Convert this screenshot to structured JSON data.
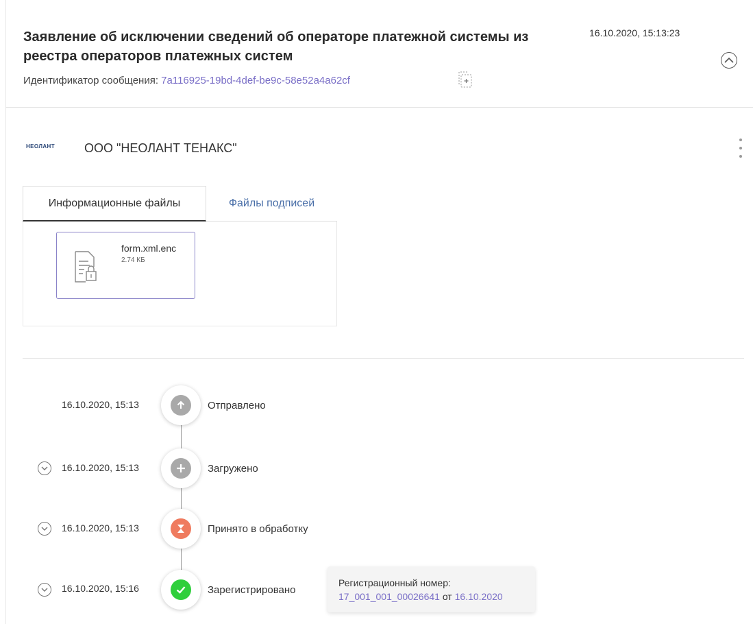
{
  "header": {
    "title": "Заявление об исключении сведений об операторе платежной системы из реестра операторов платежных систем",
    "timestamp": "16.10.2020, 15:13:23",
    "message_id_label": "Идентификатор сообщения: ",
    "message_id": "7a116925-19bd-4def-be9c-58e52a4a62cf"
  },
  "org": {
    "logo_text": "НЕОЛАНТ",
    "name": "ООО \"НЕОЛАНТ ТЕНАКС\""
  },
  "tabs": [
    {
      "label": "Информационные файлы",
      "active": true
    },
    {
      "label": "Файлы подписей",
      "active": false
    }
  ],
  "files": [
    {
      "name": "form.xml.enc",
      "size": "2.74 КБ"
    }
  ],
  "timeline": [
    {
      "time": "16.10.2020, 15:13",
      "label": "Отправлено",
      "icon": "arrow-up-icon",
      "color": "#a9a9a9",
      "expandable": false
    },
    {
      "time": "16.10.2020, 15:13",
      "label": "Загружено",
      "icon": "plus-icon",
      "color": "#a9a9a9",
      "expandable": true
    },
    {
      "time": "16.10.2020, 15:13",
      "label": "Принято в обработку",
      "icon": "hourglass-icon",
      "color": "#ef7b5f",
      "expandable": true
    },
    {
      "time": "16.10.2020, 15:16",
      "label": "Зарегистрировано",
      "icon": "check-icon",
      "color": "#2fcf3c",
      "expandable": true
    }
  ],
  "registration": {
    "label": "Регистрационный номер:",
    "number": "17_001_001_00026641",
    "from": "от",
    "date": "16.10.2020"
  },
  "colors": {
    "link": "#7a6fc7",
    "tab_link": "#4a6fa8",
    "file_border": "#8b84c9"
  }
}
